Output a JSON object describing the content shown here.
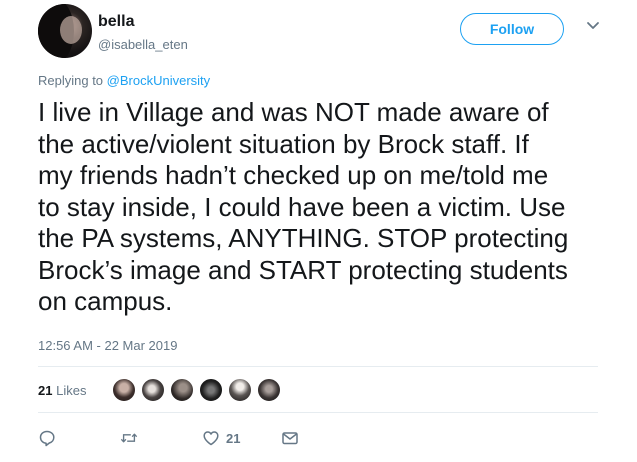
{
  "user": {
    "display_name": "bella",
    "handle": "@isabella_eten"
  },
  "follow_label": "Follow",
  "reply": {
    "prefix": "Replying to ",
    "mention": "@BrockUniversity"
  },
  "tweet": {
    "text_lines": [
      "I live in Village and was NOT made aware of",
      "the active/violent situation by Brock staff. If",
      "my friends hadn’t checked up on me/told me",
      "to stay inside, I could have been a victim. Use",
      "the PA systems, ANYTHING. STOP protecting",
      "Brock’s image and START protecting students",
      "on campus."
    ],
    "timestamp": "12:56 AM - 22 Mar 2019"
  },
  "engagement": {
    "likes_count": "21",
    "likes_label": "Likes"
  },
  "actions": {
    "like_count": "21"
  },
  "icons": {
    "reply": "reply-icon",
    "retweet": "retweet-icon",
    "like": "heart-icon",
    "message": "envelope-icon",
    "more": "chevron-down-icon"
  },
  "colors": {
    "accent": "#1da1f2",
    "text": "#14171a",
    "secondary": "#657786",
    "divider": "#e6ecf0"
  }
}
